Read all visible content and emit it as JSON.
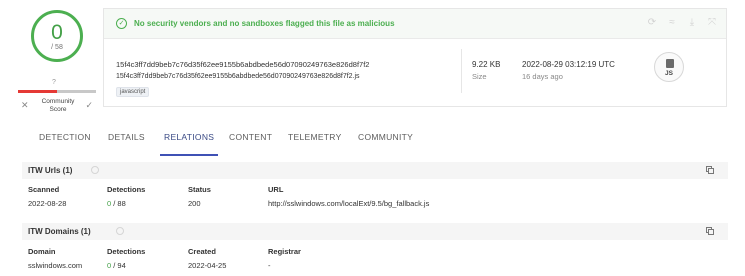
{
  "score": {
    "detected": "0",
    "total": "/ 58",
    "community_value": "?",
    "community_label_line1": "Community",
    "community_label_line2": "Score"
  },
  "summary": {
    "banner_message": "No security vendors and no sandboxes flagged this file as malicious",
    "hash": "15f4c3ff7dd9beb7c76d35f62ee9155b6abdbede56d07090249763e826d8f7f2",
    "file_name": "15f4c3ff7dd9beb7c76d35f62ee9155b6abdbede56d07090249763e826d8f7f2.js",
    "tag": "javascript",
    "size_value": "9.22 KB",
    "size_label": "Size",
    "date_value": "2022-08-29 03:12:19 UTC",
    "date_label": "16 days ago",
    "file_type": "JS"
  },
  "tabs": [
    {
      "label": "DETECTION"
    },
    {
      "label": "DETAILS"
    },
    {
      "label": "RELATIONS",
      "active": true
    },
    {
      "label": "CONTENT"
    },
    {
      "label": "TELEMETRY"
    },
    {
      "label": "COMMUNITY"
    }
  ],
  "itw_urls": {
    "title": "ITW Urls (1)",
    "columns": [
      "Scanned",
      "Detections",
      "Status",
      "URL"
    ],
    "rows": [
      {
        "scanned": "2022-08-28",
        "det_pos": "0",
        "det_total": " / 88",
        "status": "200",
        "url": "http://sslwindows.com/localExt/9.5/bg_fallback.js"
      }
    ]
  },
  "itw_domains": {
    "title": "ITW Domains (1)",
    "columns": [
      "Domain",
      "Detections",
      "Created",
      "Registrar"
    ],
    "rows": [
      {
        "domain": "sslwindows.com",
        "det_pos": "0",
        "det_total": " / 94",
        "created": "2022-04-25",
        "registrar": "-"
      }
    ]
  },
  "colors": {
    "accent": "#3f51b5",
    "clean": "#4caf50",
    "danger": "#e53935"
  }
}
